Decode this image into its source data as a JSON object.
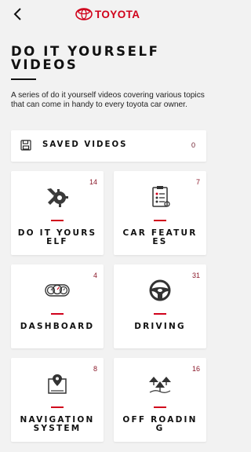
{
  "header": {
    "brand": "TOYOTA",
    "back_icon": "chevron-left-icon",
    "brand_color": "#d0021b"
  },
  "page": {
    "title": "DO IT YOURSELF VIDEOS",
    "description": "A series of do it yourself videos covering various topics that can come in handy to every toyota car owner."
  },
  "saved_videos": {
    "label": "SAVED VIDEOS",
    "count": "0",
    "icon": "save-icon"
  },
  "categories": [
    {
      "label": "DO IT YOURSELF",
      "count": "14",
      "icon": "wrench-gear-icon"
    },
    {
      "label": "CAR FEATURES",
      "count": "7",
      "icon": "clipboard-icon"
    },
    {
      "label": "DASHBOARD",
      "count": "4",
      "icon": "gauges-icon"
    },
    {
      "label": "DRIVING",
      "count": "31",
      "icon": "steering-wheel-icon"
    },
    {
      "label": "NAVIGATION SYSTEM",
      "count": "8",
      "icon": "map-pin-icon"
    },
    {
      "label": "OFF ROADING",
      "count": "16",
      "icon": "terrain-icon"
    }
  ]
}
